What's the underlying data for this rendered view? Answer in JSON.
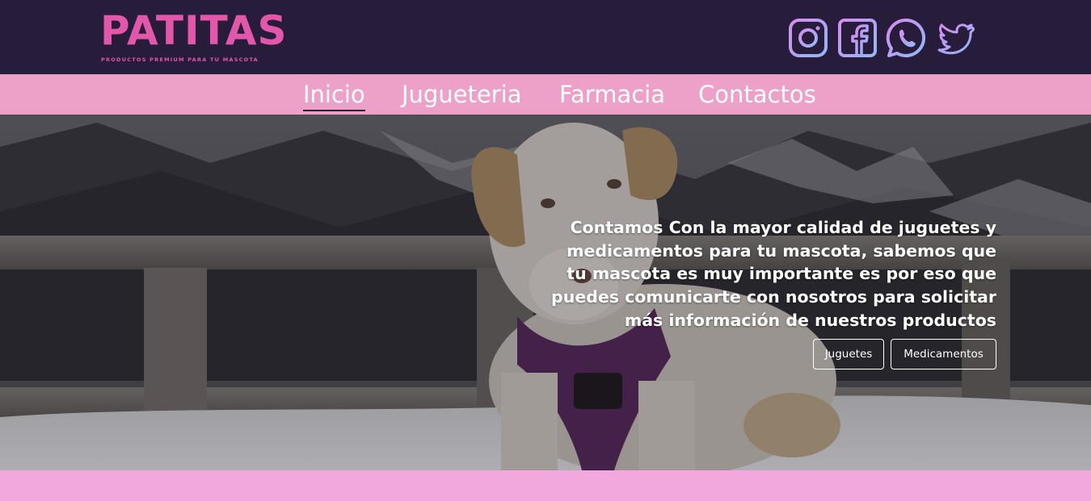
{
  "brand": {
    "name": "PATITAS",
    "tagline": "PRODUCTOS PREMIUM PARA TU MASCOTA",
    "color": "#e257a9"
  },
  "social": [
    {
      "icon": "instagram-icon"
    },
    {
      "icon": "facebook-icon"
    },
    {
      "icon": "whatsapp-icon"
    },
    {
      "icon": "twitter-icon"
    }
  ],
  "nav": {
    "items": [
      {
        "label": "Inicio",
        "active": true
      },
      {
        "label": "Jugueteria",
        "active": false
      },
      {
        "label": "Farmacia",
        "active": false
      },
      {
        "label": "Contactos",
        "active": false
      }
    ]
  },
  "hero": {
    "text": "Contamos Con la mayor calidad de juguetes y medicamentos para tu mascota, sabemos que tu mascota es muy importante es por eso que puedes comunicarte con nosotros para solicitar más información de nuestros productos",
    "buttons": [
      {
        "label": "Juguetes"
      },
      {
        "label": "Medicamentos"
      }
    ]
  },
  "colors": {
    "header_bg": "#281c3b",
    "nav_bg": "#eda1c9",
    "footer_bg": "#f3a8dd"
  }
}
